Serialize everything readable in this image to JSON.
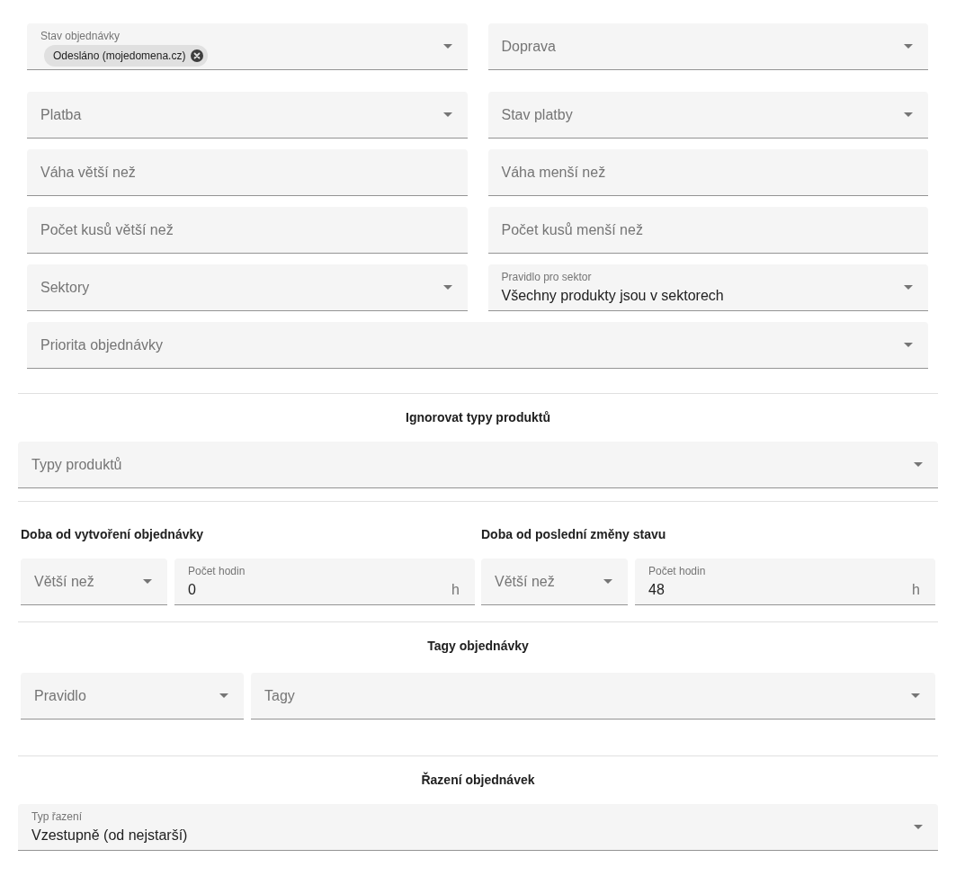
{
  "filters": {
    "rows": [
      {
        "fields": [
          {
            "kind": "select",
            "label": "Stav objednávky",
            "chips": [
              {
                "label": "Odesláno (mojedomena.cz)"
              }
            ]
          },
          {
            "kind": "select",
            "label": "Doprava"
          }
        ]
      },
      {
        "fields": [
          {
            "kind": "select",
            "label": "Platba"
          },
          {
            "kind": "select",
            "label": "Stav platby"
          }
        ]
      },
      {
        "fields": [
          {
            "kind": "input",
            "label": "Váha větší než"
          },
          {
            "kind": "input",
            "label": "Váha menší než"
          }
        ]
      },
      {
        "fields": [
          {
            "kind": "input",
            "label": "Počet kusů větší než"
          },
          {
            "kind": "input",
            "label": "Počet kusů menší než"
          }
        ]
      },
      {
        "fields": [
          {
            "kind": "select",
            "label": "Sektory"
          },
          {
            "kind": "select",
            "label": "Pravidlo pro sektor",
            "value": "Všechny produkty jsou v sektorech"
          }
        ]
      },
      {
        "fields": [
          {
            "kind": "select",
            "label": "Priorita objednávky"
          }
        ]
      }
    ]
  },
  "sections": [
    {
      "kind": "single",
      "title": "Ignorovat typy produktů",
      "fields": [
        {
          "kind": "select",
          "label": "Typy produktů"
        }
      ]
    },
    {
      "kind": "pair",
      "groups": [
        {
          "title": "Doba od vytvoření objednávky",
          "fields": [
            {
              "kind": "select",
              "label": "Větší než"
            },
            {
              "kind": "input",
              "label": "Počet hodin",
              "value": "0",
              "suffix": "h"
            }
          ]
        },
        {
          "title": "Doba od poslední změny stavu",
          "fields": [
            {
              "kind": "select",
              "label": "Větší než"
            },
            {
              "kind": "input",
              "label": "Počet hodin",
              "value": "48",
              "suffix": "h"
            }
          ]
        }
      ]
    },
    {
      "kind": "rule",
      "title": "Tagy objednávky",
      "fields": [
        {
          "kind": "select",
          "label": "Pravidlo"
        },
        {
          "kind": "select",
          "label": "Tagy"
        }
      ]
    },
    {
      "kind": "single",
      "title": "Řazení objednávek",
      "fields": [
        {
          "kind": "select",
          "label": "Typ řazení",
          "value": "Vzestupně (od nejstarší)"
        }
      ]
    }
  ]
}
